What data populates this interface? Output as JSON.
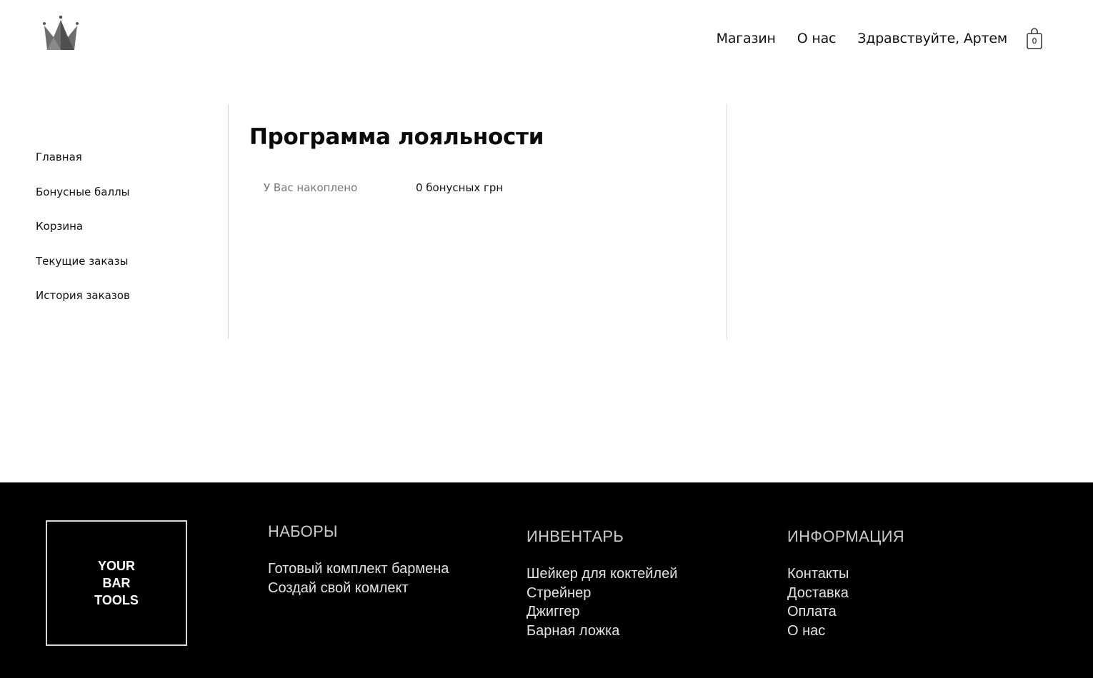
{
  "header": {
    "nav": [
      "Магазин",
      "О нас",
      "Здравствуйте, Артем"
    ],
    "cart_count": "0"
  },
  "sidebar": {
    "items": [
      {
        "label": "Главная"
      },
      {
        "label": "Бонусные баллы"
      },
      {
        "label": "Корзина"
      },
      {
        "label": "Текущие заказы"
      },
      {
        "label": "История заказов"
      }
    ]
  },
  "main": {
    "title": "Программа лояльности",
    "accumulated_label": "У Вас накоплено",
    "accumulated_value": "0 бонусных грн"
  },
  "footer": {
    "logo_text": "YOUR\nBAR\nTOOLS",
    "columns": [
      {
        "heading": "НАБОРЫ",
        "links": [
          "Готовый комплект бармена",
          "Создай свой комлект"
        ]
      },
      {
        "heading": "ИНВЕНТАРЬ",
        "links": [
          "Шейкер для коктейлей",
          "Стрейнер",
          "Джиггер",
          "Барная ложка"
        ]
      },
      {
        "heading": "ИНФОРМАЦИЯ",
        "links": [
          "Контакты",
          "Доставка",
          "Оплата",
          "О нас"
        ]
      }
    ]
  },
  "colors": {
    "footer_bg": "#000000",
    "divider": "#d6d6d6",
    "muted_text": "#777777"
  },
  "icons": [
    "crown-icon",
    "shopping-bag-icon"
  ]
}
